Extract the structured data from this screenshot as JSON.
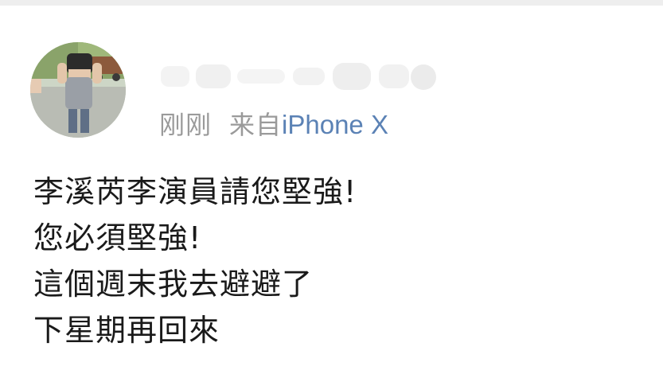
{
  "post": {
    "time": "刚刚",
    "source_prefix": "来自",
    "device": "iPhone X",
    "text_lines": [
      "李溪芮李演員請您堅強!",
      "您必須堅強!",
      "這個週末我去避避了",
      "下星期再回來"
    ]
  },
  "colors": {
    "meta_gray": "#9a9a9a",
    "link_blue": "#5b82b5",
    "text_black": "#1a1a1a"
  }
}
